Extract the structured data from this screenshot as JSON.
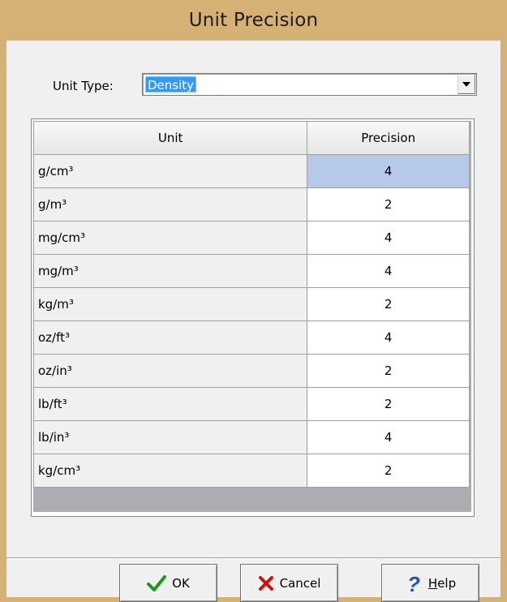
{
  "window": {
    "title": "Unit Precision"
  },
  "unit_type": {
    "label": "Unit Type:",
    "value": "Density"
  },
  "grid": {
    "columns": [
      "Unit",
      "Precision"
    ],
    "rows": [
      {
        "unit": "g/cm³",
        "precision": "4",
        "selected": true
      },
      {
        "unit": "g/m³",
        "precision": "2"
      },
      {
        "unit": "mg/cm³",
        "precision": "4"
      },
      {
        "unit": "mg/m³",
        "precision": "4"
      },
      {
        "unit": "kg/m³",
        "precision": "2"
      },
      {
        "unit": "oz/ft³",
        "precision": "4"
      },
      {
        "unit": "oz/in³",
        "precision": "2"
      },
      {
        "unit": "lb/ft³",
        "precision": "2"
      },
      {
        "unit": "lb/in³",
        "precision": "4"
      },
      {
        "unit": "kg/cm³",
        "precision": "2"
      }
    ]
  },
  "buttons": {
    "ok": {
      "label": "OK",
      "icon": "checkmark-icon"
    },
    "cancel": {
      "label": "Cancel",
      "icon": "x-icon"
    },
    "help": {
      "label": "Help",
      "icon": "question-icon"
    }
  },
  "colors": {
    "titlebar": "#d6b176",
    "selection": "#b6c9e8",
    "combo_highlight": "#3399ff"
  }
}
